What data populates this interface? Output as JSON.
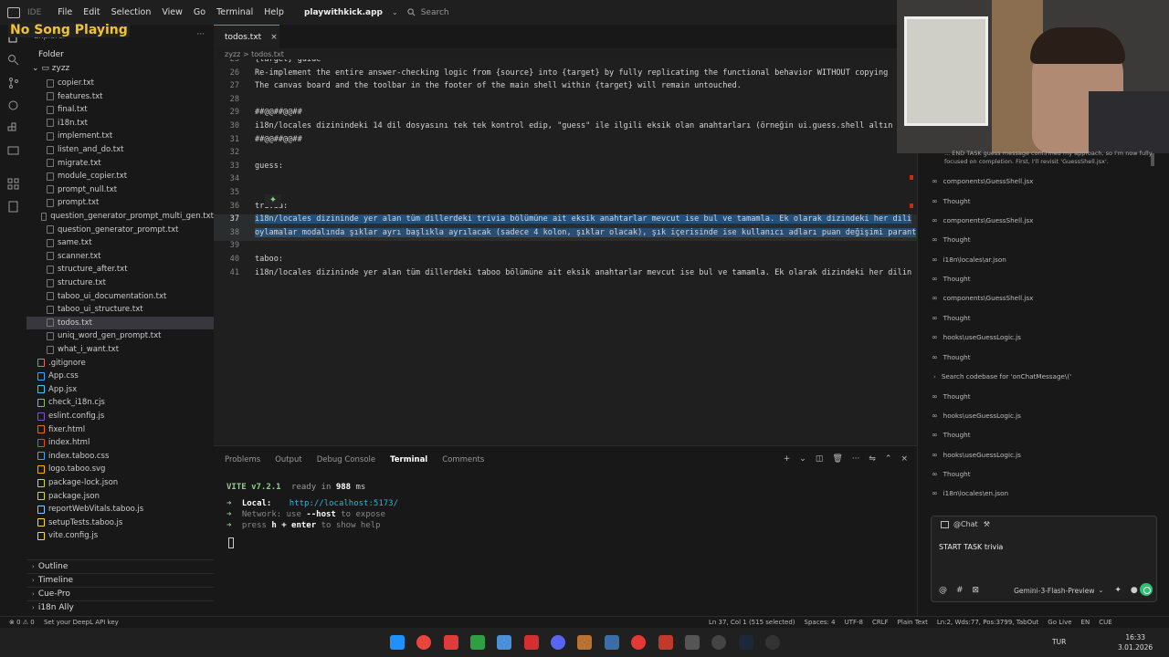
{
  "app": {
    "name": "IDE",
    "workspace": "playwithkick.app",
    "search_placeholder": "Search"
  },
  "menu": [
    "File",
    "Edit",
    "Selection",
    "View",
    "Go",
    "Terminal",
    "Help"
  ],
  "overlay": {
    "now_playing": "No Song Playing"
  },
  "sidebar": {
    "title": "Explorer",
    "root": "Folder",
    "subfolder": "zyzz",
    "files": [
      "copier.txt",
      "features.txt",
      "final.txt",
      "i18n.txt",
      "implement.txt",
      "listen_and_do.txt",
      "migrate.txt",
      "module_copier.txt",
      "prompt_null.txt",
      "prompt.txt",
      "question_generator_prompt_multi_gen.txt",
      "question_generator_prompt.txt",
      "same.txt",
      "scanner.txt",
      "structure_after.txt",
      "structure.txt",
      "taboo_ui_documentation.txt",
      "taboo_ui_structure.txt",
      "todos.txt",
      "uniq_word_gen_prompt.txt",
      "what_i_want.txt"
    ],
    "root_files": [
      ".gitignore",
      "App.css",
      "App.jsx",
      "check_i18n.cjs",
      "eslint.config.js",
      "fixer.html",
      "index.html",
      "index.taboo.css",
      "logo.taboo.svg",
      "package-lock.json",
      "package.json",
      "reportWebVitals.taboo.js",
      "setupTests.taboo.js",
      "vite.config.js"
    ],
    "active_file": "todos.txt",
    "sections": [
      "Outline",
      "Timeline",
      "Cue-Pro",
      "i18n Ally"
    ]
  },
  "editor": {
    "tab": "todos.txt",
    "breadcrumb": "zyzz > todos.txt",
    "lines": [
      {
        "n": "25",
        "text": "{target} guide"
      },
      {
        "n": "26",
        "text": "Re-implement the entire answer-checking logic from {source} into {target} by fully replicating the functional behavior WITHOUT copying"
      },
      {
        "n": "27",
        "text": "The canvas board and the toolbar in the footer of the main shell within {target} will remain untouched."
      },
      {
        "n": "28",
        "text": ""
      },
      {
        "n": "29",
        "text": "##@@##@@##"
      },
      {
        "n": "30",
        "text": "i18n/locales dizinindeki 14 dil dosyasını tek tek kontrol edip, \"guess\" ile ilgili eksik olan anahtarları (örneğin ui.guess.shell altın"
      },
      {
        "n": "31",
        "text": "##@@##@@##"
      },
      {
        "n": "32",
        "text": ""
      },
      {
        "n": "33",
        "text": "guess:"
      },
      {
        "n": "34",
        "text": ""
      },
      {
        "n": "35",
        "text": ""
      },
      {
        "n": "36",
        "text": "trivia:"
      },
      {
        "n": "37",
        "text": "i18n/locales dizininde yer alan tüm dillerdeki trivia bölümüne ait eksik anahtarlar mevcut ise bul ve tamamla. Ek olarak dizindeki her dili"
      },
      {
        "n": "38",
        "text": "oylamalar modalında şıklar ayrı başlıkla ayrılacak (sadece 4 kolon, şıklar olacak), şık içerisinde ise kullanıcı adları puan değişimi parant"
      },
      {
        "n": "39",
        "text": ""
      },
      {
        "n": "40",
        "text": "taboo:"
      },
      {
        "n": "41",
        "text": "i18n/locales dizininde yer alan tüm dillerdeki taboo bölümüne ait eksik anahtarlar mevcut ise bul ve tamamla. Ek olarak dizindeki her dilin"
      }
    ]
  },
  "panel": {
    "tabs": [
      "Problems",
      "Output",
      "Debug Console",
      "Terminal",
      "Comments"
    ],
    "active_tab": "Terminal",
    "terminal": {
      "vite": "VITE v7.2.1",
      "ready": "ready in",
      "ms_value": "988",
      "ms_unit": "ms",
      "local_label": "Local:",
      "local_url": "http://localhost:5173/",
      "network_label": "Network:",
      "network_text": "use",
      "host_flag": "--host",
      "network_suffix": "to expose",
      "press": "press",
      "keys": "h + enter",
      "help": "to show help"
    }
  },
  "chat": {
    "partial_text": "... END TASK guess message confirmed my approach, so I'm now fully focused on completion. First, I'll revisit 'GuessShell.jsx'.",
    "items": [
      {
        "label": "components\\GuessShell.jsx",
        "kind": "file"
      },
      {
        "label": "Thought",
        "kind": "thought"
      },
      {
        "label": "components\\GuessShell.jsx",
        "kind": "file"
      },
      {
        "label": "Thought",
        "kind": "thought"
      },
      {
        "label": "i18n\\locales\\ar.json",
        "kind": "file"
      },
      {
        "label": "Thought",
        "kind": "thought"
      },
      {
        "label": "components\\GuessShell.jsx",
        "kind": "file"
      },
      {
        "label": "Thought",
        "kind": "thought"
      },
      {
        "label": "hooks\\useGuessLogic.js",
        "kind": "file"
      },
      {
        "label": "Thought",
        "kind": "thought"
      },
      {
        "label": "Search codebase for 'onChatMessage\\('",
        "kind": "search"
      },
      {
        "label": "Thought",
        "kind": "thought"
      },
      {
        "label": "hooks\\useGuessLogic.js",
        "kind": "file"
      },
      {
        "label": "Thought",
        "kind": "thought"
      },
      {
        "label": "hooks\\useGuessLogic.js",
        "kind": "file"
      },
      {
        "label": "Thought",
        "kind": "thought"
      },
      {
        "label": "i18n\\locales\\en.json",
        "kind": "file"
      }
    ],
    "input": {
      "header": "@Chat",
      "text": "START TASK trivia",
      "model": "Gemini-3-Flash-Preview"
    }
  },
  "statusbar": {
    "left": "Set your DeepL API key",
    "position": "Ln 37, Col 1 (515 selected)",
    "spaces": "Spaces: 4",
    "encoding": "UTF-8",
    "eol": "CRLF",
    "lang": "Plain Text",
    "extra": "Ln:2, Wds:77, Pos:3799, TabOut",
    "golive": "Go Live",
    "locale": "EN",
    "kbd": "CUE"
  },
  "taskbar": {
    "lang": "TUR",
    "time": "16:33",
    "date": "3.01.2026"
  },
  "colors": {
    "accent": "#3794ff",
    "selection": "#264f78",
    "send": "#2fbf71",
    "vite_green": "#89d185",
    "url_cyan": "#29b8db"
  }
}
